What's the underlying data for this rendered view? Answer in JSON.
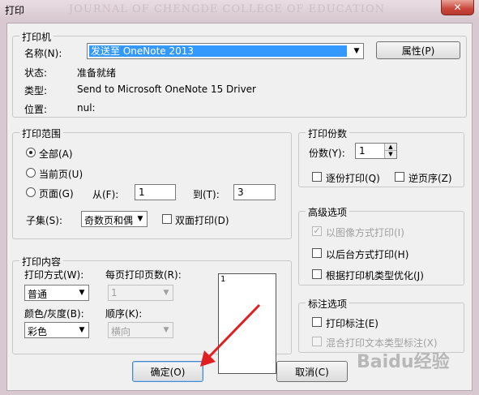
{
  "window": {
    "title": "打印",
    "watermark": "JOURNAL OF CHENGDE COLLEGE OF EDUCATION"
  },
  "printer": {
    "legend": "打印机",
    "name_label": "名称(N):",
    "name_value": "发送至 OneNote 2013",
    "properties_button": "属性(P)",
    "status_label": "状态:",
    "status_value": "准备就绪",
    "type_label": "类型:",
    "type_value": "Send to Microsoft OneNote 15 Driver",
    "location_label": "位置:",
    "location_value": "nul:"
  },
  "range": {
    "legend": "打印范围",
    "all": "全部(A)",
    "current": "当前页(U)",
    "pages": "页面(G)",
    "from_label": "从(F):",
    "from_value": "1",
    "to_label": "到(T):",
    "to_value": "3",
    "subset_label": "子集(S):",
    "subset_value": "奇数页和偶",
    "duplex": "双面打印(D)"
  },
  "copies": {
    "legend": "打印份数",
    "count_label": "份数(Y):",
    "count_value": "1",
    "collate": "逐份打印(Q)",
    "reverse": "逆页序(Z)"
  },
  "advanced": {
    "legend": "高级选项",
    "image_mode": "以图像方式打印(I)",
    "background": "以后台方式打印(H)",
    "optimize": "根据打印机类型优化(J)"
  },
  "content": {
    "legend": "打印内容",
    "mode_label": "打印方式(W):",
    "mode_value": "普通",
    "pages_per_sheet_label": "每页打印页数(R):",
    "pages_per_sheet_value": "1",
    "color_label": "颜色/灰度(B):",
    "color_value": "彩色",
    "order_label": "顺序(K):",
    "order_value": "横向",
    "preview_page": "1"
  },
  "annotation": {
    "legend": "标注选项",
    "print_annotation": "打印标注(E)",
    "mixed": "混合打印文本类型标注(X)"
  },
  "buttons": {
    "ok": "确定(O)",
    "cancel": "取消(C)"
  },
  "overlay": {
    "watermark": "Baidu经验"
  },
  "colors": {
    "selection": "#3399ff",
    "arrow": "#e02020",
    "close": "#c9473a"
  }
}
